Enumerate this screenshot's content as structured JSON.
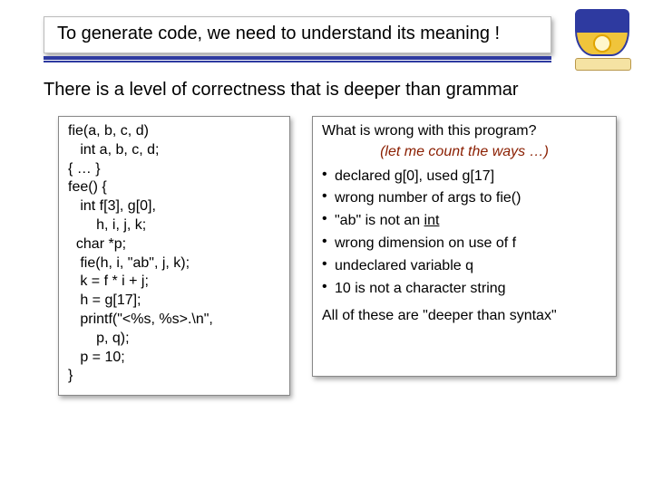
{
  "title": "To generate code, we need to understand its meaning !",
  "subhead": "There is a level of correctness that is deeper than grammar",
  "code": "fie(a, b, c, d)\n   int a, b, c, d;\n{ … }\nfee() {\n   int f[3], g[0],\n       h, i, j, k;\n  char *p;\n   fie(h, i, \"ab\", j, k);\n   k = f * i + j;\n   h = g[17];\n   printf(\"<%s, %s>.\\n\",\n       p, q);\n   p = 10;\n}",
  "question": "What is wrong with this program?",
  "question_sub": "(let me count the ways …)",
  "bullets": [
    "declared g[0], used g[17]",
    "wrong number of args to fie()",
    "\"ab\" is not an ",
    "wrong dimension on use of f",
    "undeclared variable q",
    "10 is not a character string"
  ],
  "bullet3_tail": "int",
  "footer": "All of these are  \"deeper than syntax\"",
  "logo_alt": "University of Delaware crest"
}
